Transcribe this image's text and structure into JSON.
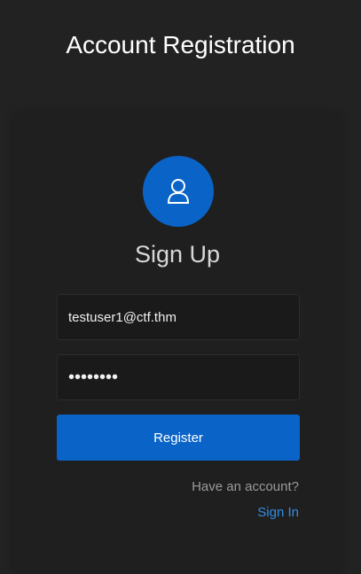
{
  "page": {
    "title": "Account Registration"
  },
  "card": {
    "avatar_icon": "user-icon",
    "title": "Sign Up",
    "email_value": "testuser1@ctf.thm",
    "password_value": "••••••••",
    "register_label": "Register",
    "have_account_text": "Have an account?",
    "signin_label": "Sign In"
  },
  "colors": {
    "background": "#222222",
    "card": "#1f1f1f",
    "accent": "#0a64c8",
    "link": "#2f8fe8",
    "muted_text": "#9a9a9a"
  }
}
